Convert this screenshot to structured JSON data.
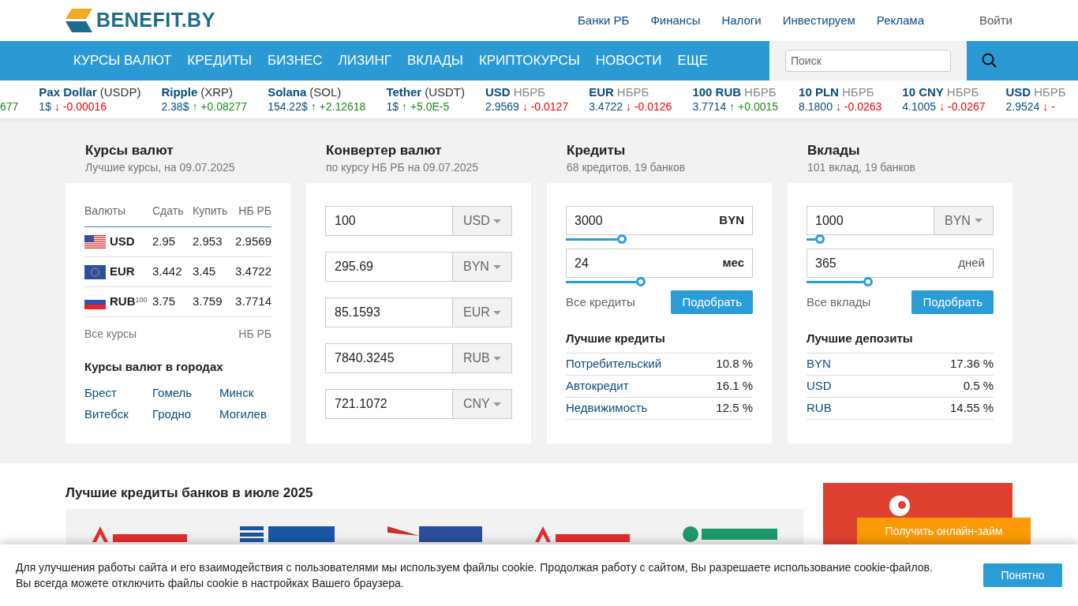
{
  "logo": {
    "text": "BENEFIT.BY"
  },
  "top_links": [
    "Банки РБ",
    "Финансы",
    "Налоги",
    "Инвестируем",
    "Реклама"
  ],
  "login": "Войти",
  "nav": [
    "КУРСЫ ВАЛЮТ",
    "КРЕДИТЫ",
    "БИЗНЕС",
    "ЛИЗИНГ",
    "ВКЛАДЫ",
    "КРИПТОКУРСЫ",
    "НОВОСТИ",
    "ЕЩЕ"
  ],
  "search": {
    "placeholder": "Поиск"
  },
  "ticker": [
    {
      "change": "677",
      "rising": true
    },
    {
      "name": "Pax Dollar",
      "code": "(USDP)",
      "kind": "crypto",
      "value": "1$",
      "change": "↓ -0.00016",
      "rising": false
    },
    {
      "name": "Ripple",
      "code": "(XRP)",
      "kind": "crypto",
      "value": "2.38$",
      "change": "↑ +0.08277",
      "rising": true
    },
    {
      "name": "Solana",
      "code": "(SOL)",
      "kind": "crypto",
      "value": "154.22$",
      "change": "↑ +2.12618",
      "rising": true
    },
    {
      "name": "Tether",
      "code": "(USDT)",
      "kind": "crypto",
      "value": "1$",
      "change": "↑ +5.0E-5",
      "rising": true
    },
    {
      "name": "USD",
      "code": "НБРБ",
      "kind": "nbrb",
      "value": "2.9569",
      "change": "↓ -0.0127",
      "rising": false
    },
    {
      "name": "EUR",
      "code": "НБРБ",
      "kind": "nbrb",
      "value": "3.4722",
      "change": "↓ -0.0126",
      "rising": false
    },
    {
      "name": "100 RUB",
      "code": "НБРБ",
      "kind": "nbrb",
      "value": "3.7714",
      "change": "↑ +0.0015",
      "rising": true
    },
    {
      "name": "10 PLN",
      "code": "НБРБ",
      "kind": "nbrb",
      "value": "8.1800",
      "change": "↓ -0.0263",
      "rising": false
    },
    {
      "name": "10 CNY",
      "code": "НБРБ",
      "kind": "nbrb",
      "value": "4.1005",
      "change": "↓ -0.0267",
      "rising": false
    },
    {
      "name": "USD",
      "code": "НБРБ",
      "kind": "nbrb",
      "value": "2.9524",
      "change": "↓ -",
      "rising": false
    }
  ],
  "rates": {
    "title": "Курсы валют",
    "subtitle": "Лучшие курсы, на 09.07.2025",
    "columns": [
      "Валюты",
      "Сдать",
      "Купить",
      "НБ РБ"
    ],
    "rows": [
      {
        "kind": "us",
        "code": "USD",
        "sell": "2.95",
        "buy": "2.953",
        "nb": "2.9569"
      },
      {
        "kind": "eu",
        "code": "EUR",
        "sell": "3.442",
        "buy": "3.45",
        "nb": "3.4722"
      },
      {
        "kind": "ru",
        "code": "RUB$^{100}$",
        "sell": "3.75",
        "buy": "3.759",
        "nb": "3.7714"
      }
    ],
    "all_link": "Все курсы",
    "nb_link": "НБ РБ",
    "cities_title": "Курсы валют в городах",
    "cities": [
      "Брест",
      "Гомель",
      "Минск",
      "Витебск",
      "Гродно",
      "Могилев"
    ]
  },
  "converter": {
    "title": "Конвертер валют",
    "subtitle": "по курсу НБ РБ на 09.07.2025",
    "rows": [
      {
        "value": "100",
        "currency": "USD"
      },
      {
        "value": "295.69",
        "currency": "BYN"
      },
      {
        "value": "85.1593",
        "currency": "EUR"
      },
      {
        "value": "7840.3245",
        "currency": "RUB"
      },
      {
        "value": "721.1072",
        "currency": "CNY"
      }
    ]
  },
  "credits": {
    "title": "Кредиты",
    "subtitle": "68 кредитов, 19 банков",
    "fields": [
      {
        "value": "3000",
        "unit": "BYN",
        "kind": "unit",
        "level": 0.3
      },
      {
        "value": "24",
        "unit": "мес",
        "kind": "unit",
        "level": 0.4
      }
    ],
    "all_link": "Все кредиты",
    "button": "Подобрать",
    "best_title": "Лучшие кредиты",
    "best": [
      {
        "name": "Потребительский",
        "rate": "10.8 %"
      },
      {
        "name": "Автокредит",
        "rate": "16.1 %"
      },
      {
        "name": "Недвижимость",
        "rate": "12.5 %"
      }
    ]
  },
  "deposits": {
    "title": "Вклады",
    "subtitle": "101 вклад, 19 банков",
    "fields": [
      {
        "value": "1000",
        "unit": "BYN",
        "kind": "select",
        "level": 0.07
      },
      {
        "value": "365",
        "unit": "дней",
        "kind": "unit",
        "level": 0.33
      }
    ],
    "all_link": "Все вклады",
    "button": "Подобрать",
    "best_title": "Лучшие депозиты",
    "best": [
      {
        "name": "BYN",
        "rate": "17.36 %"
      },
      {
        "name": "USD",
        "rate": "0.5 %"
      },
      {
        "name": "RUB",
        "rate": "14.55 %"
      }
    ]
  },
  "best_loans": {
    "title": "Лучшие кредиты банков в июле 2025"
  },
  "ad": {
    "button": "Получить онлайн-займ"
  },
  "cookie": {
    "text": "Для улучшения работы сайта и его взаимодействия с пользователями мы используем файлы cookie. Продолжая работу с сайтом, Вы разрешаете использование cookie-файлов. Вы всегда можете отключить файлы cookie в настройках Вашего браузера.",
    "button": "Понятно"
  }
}
